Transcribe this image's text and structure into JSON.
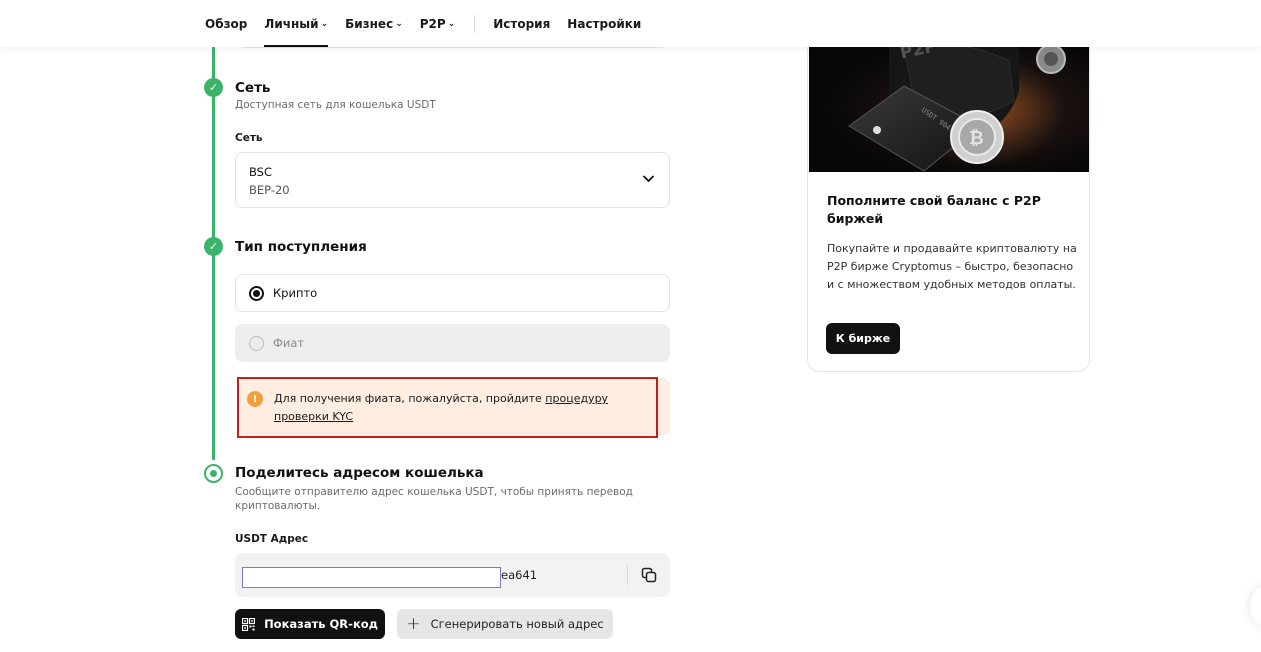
{
  "nav": {
    "items": [
      {
        "label": "Обзор",
        "dropdown": false,
        "active": false
      },
      {
        "label": "Личный",
        "dropdown": true,
        "active": true
      },
      {
        "label": "Бизнес",
        "dropdown": true,
        "active": false
      },
      {
        "label": "P2P",
        "dropdown": true,
        "active": false
      }
    ],
    "history": "История",
    "settings": "Настройки"
  },
  "network_step": {
    "title": "Сеть",
    "subtitle": "Доступная сеть для кошелька USDT",
    "field_label": "Сеть",
    "selected_line1": "BSC",
    "selected_line2": "BEP-20"
  },
  "receipt_step": {
    "title": "Тип поступления",
    "options": [
      {
        "label": "Крипто",
        "selected": true,
        "disabled": false
      },
      {
        "label": "Фиат",
        "selected": false,
        "disabled": true
      }
    ],
    "alert_text": "Для получения фиата, пожалуйста, пройдите ",
    "alert_link": "процедуру проверки KYC",
    "alert_icon": "!"
  },
  "share_step": {
    "title": "Поделитесь адресом кошелька",
    "subtitle": "Сообщите отправителю адрес кошелька USDT, чтобы принять перевод криптовалюты.",
    "field_label": "USDT Адрес",
    "address_tail": "ea641",
    "show_qr": "Показать QR-код",
    "generate": "Сгенерировать новый адрес"
  },
  "promo": {
    "title": "Пополните свой баланс с P2P биржей",
    "text": "Покупайте и продавайте криптовалюту на P2P бирже Cryptomus – быстро, безопасно и с множеством удобных методов оплаты.",
    "button": "К бирже",
    "image_text": "P2P"
  },
  "colors": {
    "accent_green": "#3bb36a",
    "alert_bg": "#fdeee1",
    "alert_border": "#c21f1f",
    "alert_icon": "#f2a03d"
  }
}
